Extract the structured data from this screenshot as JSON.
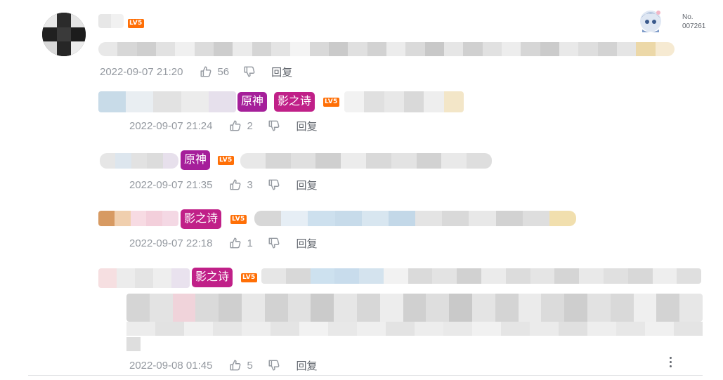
{
  "main_comment": {
    "level": "LV5",
    "time": "2022-09-07 21:20",
    "likes": "56",
    "reply_label": "回复"
  },
  "fan_badge": {
    "label": "No.",
    "number": "007261"
  },
  "replies": [
    {
      "tags": [
        "原神",
        "影之诗"
      ],
      "level": "LV5",
      "time": "2022-09-07 21:24",
      "likes": "2",
      "reply_label": "回复"
    },
    {
      "tags": [
        "原神"
      ],
      "level": "LV5",
      "time": "2022-09-07 21:35",
      "likes": "3",
      "reply_label": "回复"
    },
    {
      "tags": [
        "影之诗"
      ],
      "level": "LV5",
      "time": "2022-09-07 22:18",
      "likes": "1",
      "reply_label": "回复"
    },
    {
      "tags": [
        "影之诗"
      ],
      "level": "LV5",
      "time": "2022-09-08 01:45",
      "likes": "5",
      "reply_label": "回复"
    }
  ],
  "colors": {
    "level_badge": "#ff6f06",
    "tag_genshin": "#a51f9a",
    "tag_shadowverse": "#c02088",
    "meta_text": "#9499a0"
  },
  "icons": {
    "like": "thumbs-up-icon",
    "dislike": "thumbs-down-icon",
    "more": "more-vertical-icon"
  }
}
